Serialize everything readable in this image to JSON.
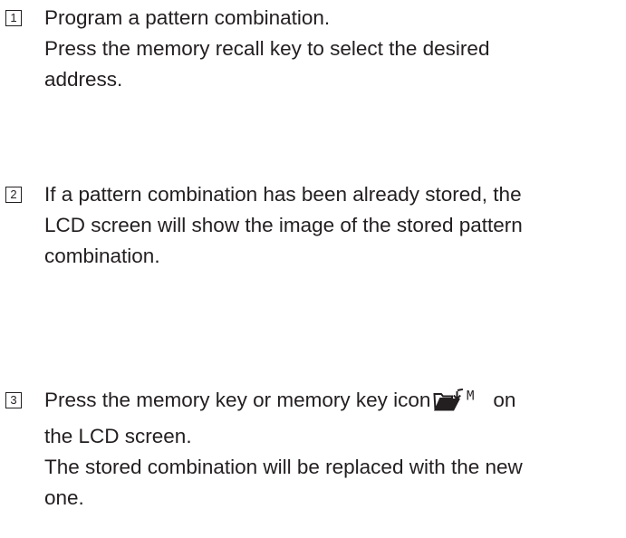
{
  "steps": [
    {
      "number": "1",
      "lines": [
        "Program a pattern combination.",
        "Press the memory recall key to select the desired",
        "address."
      ]
    },
    {
      "number": "2",
      "lines": [
        "If a pattern combination has been already stored, the",
        "LCD screen will show the image of the stored pattern",
        "combination."
      ]
    },
    {
      "number": "3",
      "line1_text": "Press the memory key or memory key icon",
      "line1_after_icon": "on",
      "icon_name": "memory-key-icon",
      "icon_letter": "M",
      "lines_rest": [
        "the LCD screen.",
        "The stored combination will be replaced with the new",
        "one."
      ]
    }
  ]
}
